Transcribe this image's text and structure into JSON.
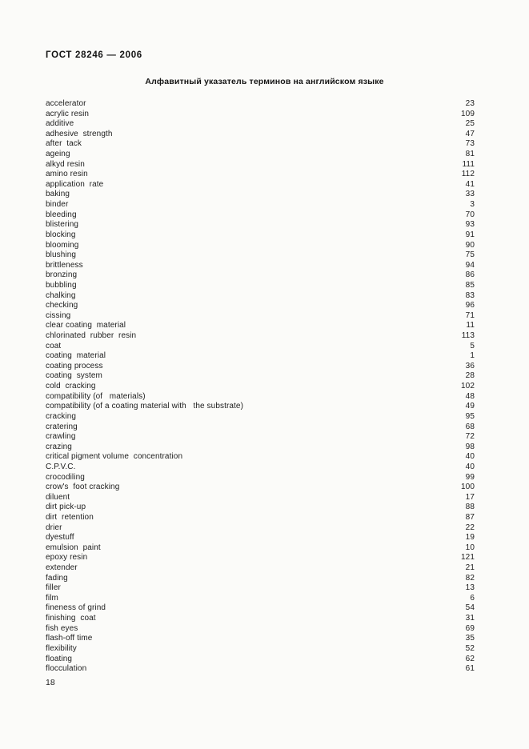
{
  "document": {
    "standard_header": "ГОСТ 28246 — 2006",
    "index_title": "Алфавитный указатель терминов на английском языке",
    "folio": "18"
  },
  "index": {
    "entries": [
      {
        "term": "accelerator",
        "page": "23"
      },
      {
        "term": "acrylic resin",
        "page": "109"
      },
      {
        "term": "additive",
        "page": "25"
      },
      {
        "term": "adhesive  strength",
        "page": "47"
      },
      {
        "term": "after  tack",
        "page": "73"
      },
      {
        "term": "ageing",
        "page": "81"
      },
      {
        "term": "alkyd resin",
        "page": "111"
      },
      {
        "term": "amino resin",
        "page": "112"
      },
      {
        "term": "application  rate",
        "page": "41"
      },
      {
        "term": "baking",
        "page": "33"
      },
      {
        "term": "binder",
        "page": "3"
      },
      {
        "term": "bleeding",
        "page": "70"
      },
      {
        "term": "blistering",
        "page": "93"
      },
      {
        "term": "blocking",
        "page": "91"
      },
      {
        "term": "blooming",
        "page": "90"
      },
      {
        "term": "blushing",
        "page": "75"
      },
      {
        "term": "brittleness",
        "page": "94"
      },
      {
        "term": "bronzing",
        "page": "86"
      },
      {
        "term": "bubbling",
        "page": "85"
      },
      {
        "term": "chalking",
        "page": "83"
      },
      {
        "term": "checking",
        "page": "96"
      },
      {
        "term": "cissing",
        "page": "71"
      },
      {
        "term": "clear coating  material",
        "page": "11"
      },
      {
        "term": "chlorinated  rubber  resin",
        "page": "113"
      },
      {
        "term": "coat",
        "page": "5"
      },
      {
        "term": "coating  material",
        "page": "1"
      },
      {
        "term": "coating process",
        "page": "36"
      },
      {
        "term": "coating  system",
        "page": "28"
      },
      {
        "term": "cold  cracking",
        "page": "102"
      },
      {
        "term": "compatibility (of   materials)",
        "page": "48"
      },
      {
        "term": "compatibility (of a coating material with   the substrate)",
        "page": "49"
      },
      {
        "term": "cracking",
        "page": "95"
      },
      {
        "term": "cratering",
        "page": "68"
      },
      {
        "term": "crawling",
        "page": "72"
      },
      {
        "term": "crazing",
        "page": "98"
      },
      {
        "term": "critical pigment volume  concentration",
        "page": "40"
      },
      {
        "term": "C.P.V.C.",
        "page": "40"
      },
      {
        "term": "crocodiling",
        "page": "99"
      },
      {
        "term": "crow's  foot cracking",
        "page": "100"
      },
      {
        "term": "diluent",
        "page": "17"
      },
      {
        "term": "dirt pick-up",
        "page": "88"
      },
      {
        "term": "dirt  retention",
        "page": "87"
      },
      {
        "term": "drier",
        "page": "22"
      },
      {
        "term": "dyestuff",
        "page": "19"
      },
      {
        "term": "emulsion  paint",
        "page": "10"
      },
      {
        "term": "epoxy resin",
        "page": "121"
      },
      {
        "term": "extender",
        "page": "21"
      },
      {
        "term": "fading",
        "page": "82"
      },
      {
        "term": "filler",
        "page": "13"
      },
      {
        "term": "film",
        "page": "6"
      },
      {
        "term": "fineness of grind",
        "page": "54"
      },
      {
        "term": "finishing  coat",
        "page": "31"
      },
      {
        "term": "fish eyes",
        "page": "69"
      },
      {
        "term": "flash-off time",
        "page": "35"
      },
      {
        "term": "flexibility",
        "page": "52"
      },
      {
        "term": "floating",
        "page": "62"
      },
      {
        "term": "flocculation",
        "page": "61"
      }
    ]
  }
}
